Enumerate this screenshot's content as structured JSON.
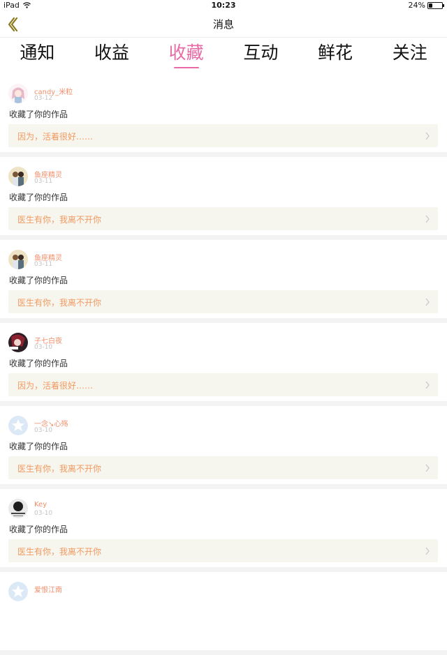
{
  "status_bar": {
    "device": "iPad",
    "time": "10:23",
    "battery": "24%",
    "battery_level": 0.24
  },
  "header": {
    "title": "消息"
  },
  "tabs": [
    {
      "label": "通知"
    },
    {
      "label": "收益"
    },
    {
      "label": "收藏",
      "active": true
    },
    {
      "label": "互动"
    },
    {
      "label": "鲜花"
    },
    {
      "label": "关注"
    }
  ],
  "colors": {
    "accent": "#e86aa6",
    "username": "#f08f6b",
    "work_title": "#f09a62",
    "work_bg": "#f7f6ee"
  },
  "items": [
    {
      "user": "candy_米粒",
      "date": "03-12",
      "message": "收藏了你的作品",
      "work_title": "因为，活着很好……",
      "avatar": "anime-girl-avatar"
    },
    {
      "user": "鱼座精灵",
      "date": "03-11",
      "message": "收藏了你的作品",
      "work_title": "医生有你，我离不开你",
      "avatar": "couple-avatar"
    },
    {
      "user": "鱼座精灵",
      "date": "03-11",
      "message": "收藏了你的作品",
      "work_title": "医生有你，我离不开你",
      "avatar": "couple-avatar"
    },
    {
      "user": "子七白夜",
      "date": "03-10",
      "message": "收藏了你的作品",
      "work_title": "因为，活着很好……",
      "avatar": "dark-anime-avatar"
    },
    {
      "user": "一念↘心殇",
      "date": "03-10",
      "message": "收藏了你的作品",
      "work_title": "医生有你，我离不开你",
      "avatar": "default-star-avatar"
    },
    {
      "user": "Key",
      "date": "03-10",
      "message": "收藏了你的作品",
      "work_title": "医生有你，我离不开你",
      "avatar": "bw-photo-avatar"
    },
    {
      "user": "爱恨江南",
      "date": "",
      "message": "",
      "work_title": "",
      "avatar": "default-star-avatar"
    }
  ]
}
